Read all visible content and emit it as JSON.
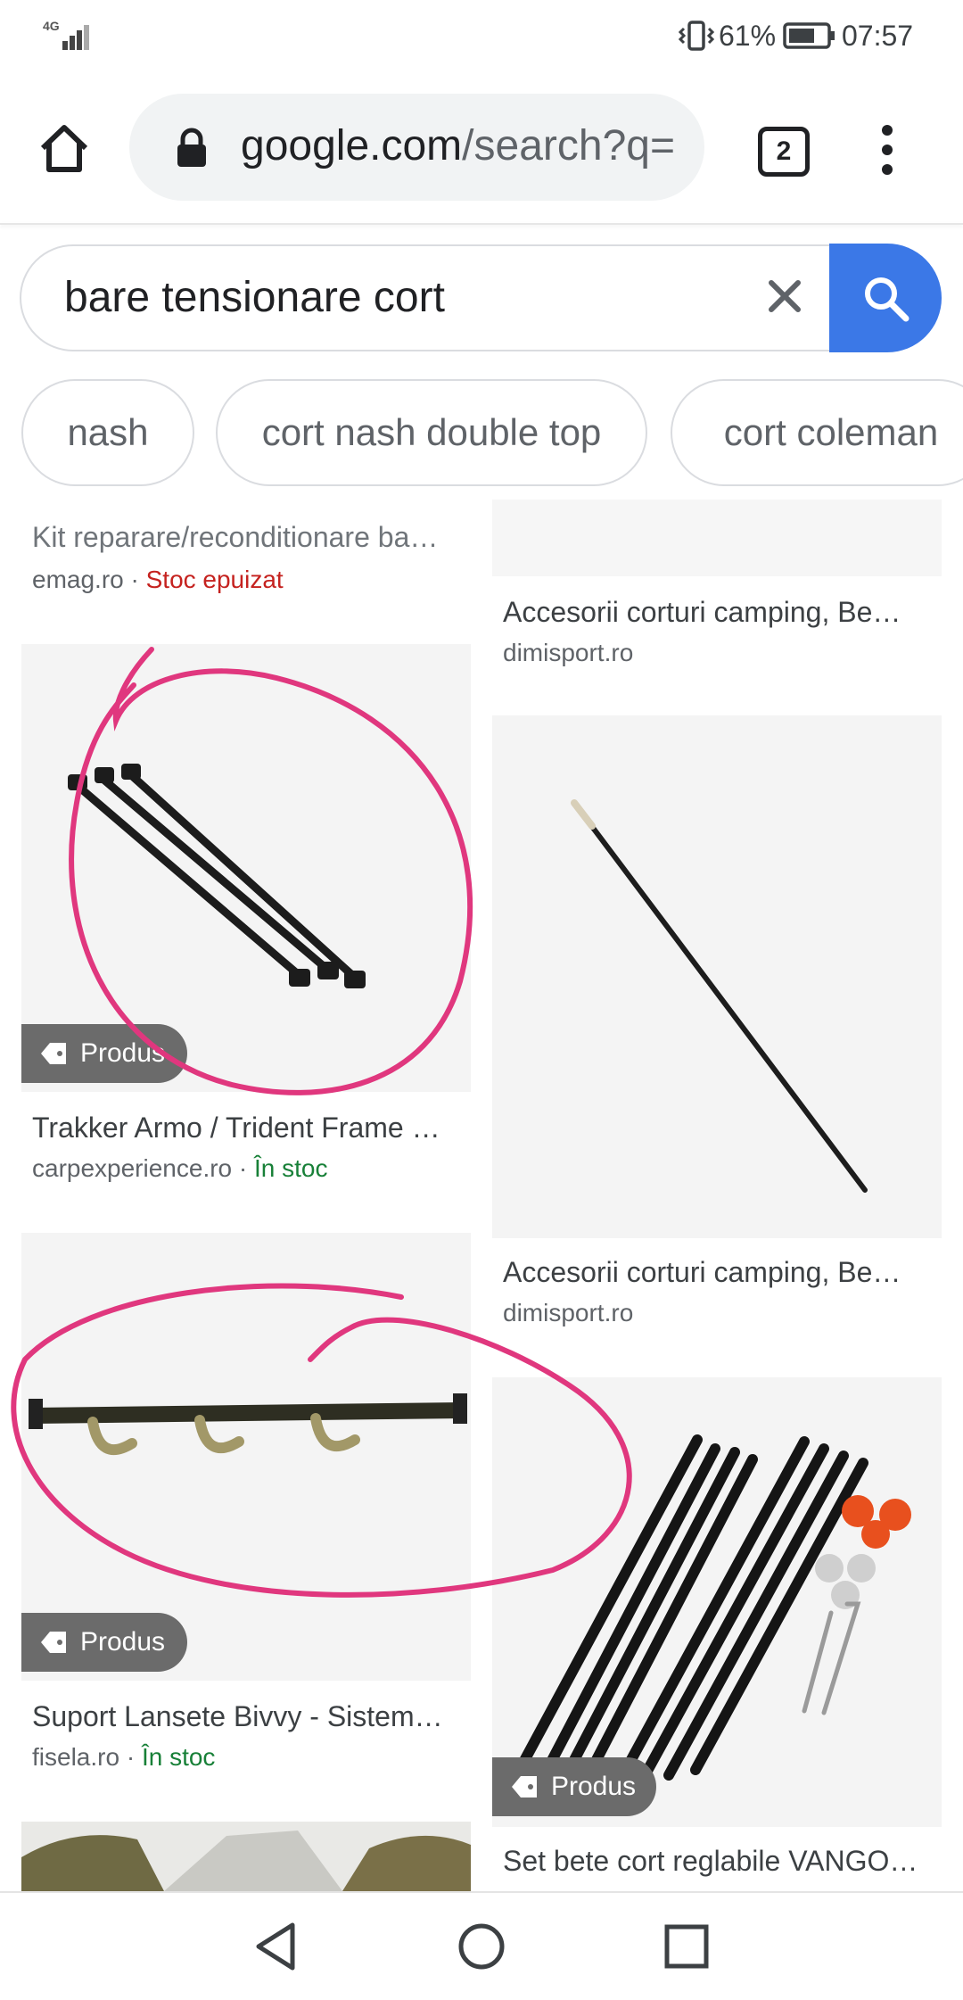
{
  "status_bar": {
    "network": "4G",
    "battery": "61%",
    "time": "07:57"
  },
  "browser": {
    "url_host": "google.com",
    "url_path": "/search?q=",
    "tab_count": "2"
  },
  "search": {
    "query": "bare tensionare cort"
  },
  "chips": [
    "nash",
    "cort nash double top",
    "cort coleman"
  ],
  "results": {
    "left": [
      {
        "title": "Kit reparare/reconditionare ba…",
        "source": "emag.ro",
        "stock": "Stoc epuizat"
      },
      {
        "title": "Trakker Armo / Trident Frame …",
        "source": "carpexperience.ro",
        "stock": "În stoc",
        "badge": "Produs"
      },
      {
        "title": "Suport Lansete Bivvy - Sistem…",
        "source": "fisela.ro",
        "stock": "În stoc",
        "badge": "Produs"
      }
    ],
    "right": [
      {
        "title": "Accesorii corturi camping, Be…",
        "source": "dimisport.ro"
      },
      {
        "title": "Accesorii corturi camping, Be…",
        "source": "dimisport.ro"
      },
      {
        "title": "Set bete cort reglabile VANGO…",
        "badge": "Produs"
      }
    ],
    "separator": " · "
  },
  "colors": {
    "search_button": "#3b78e7",
    "annotation": "#e0377e",
    "out_of_stock": "#c5221f",
    "in_stock": "#188038"
  }
}
